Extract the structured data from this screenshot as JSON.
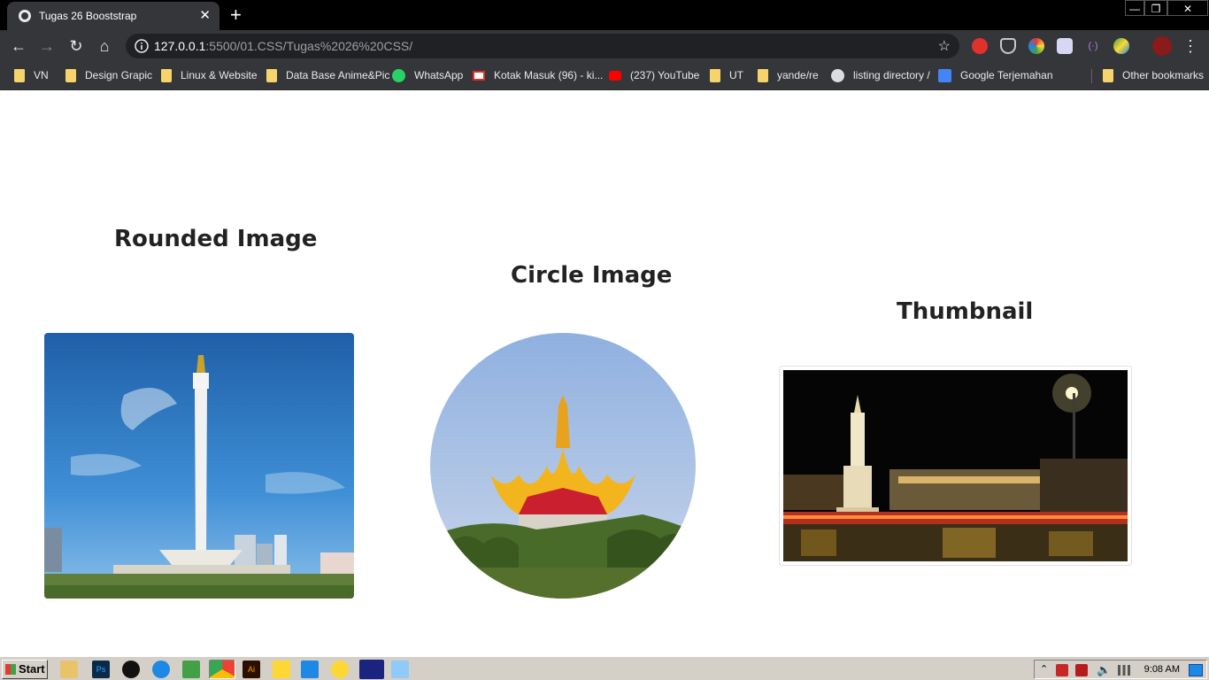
{
  "browser": {
    "tab_title": "Tugas 26 Booststrap",
    "tab_close": "✕",
    "new_tab": "+",
    "url_host": "127.0.0.1",
    "url_rest": ":5500/01.CSS/Tugas%2026%20CSS/",
    "window_controls": {
      "minimize": "—",
      "maximize": "❐",
      "close": "✕"
    }
  },
  "bookmarks": [
    {
      "label": "VN",
      "icon": "folder-icon"
    },
    {
      "label": "Design Grapic",
      "icon": "folder-icon"
    },
    {
      "label": "Linux & Website",
      "icon": "folder-icon"
    },
    {
      "label": "Data Base Anime&Pic",
      "icon": "folder-icon"
    },
    {
      "label": "WhatsApp",
      "icon": "whatsapp-icon"
    },
    {
      "label": "Kotak Masuk (96) - ki...",
      "icon": "gmail-icon"
    },
    {
      "label": "(237) YouTube",
      "icon": "youtube-icon"
    },
    {
      "label": "UT",
      "icon": "folder-icon"
    },
    {
      "label": "yande/re",
      "icon": "folder-icon"
    },
    {
      "label": "listing directory /",
      "icon": "globe-icon"
    },
    {
      "label": "Google Terjemahan",
      "icon": "google-translate-icon"
    },
    {
      "label": "Other bookmarks",
      "icon": "folder-icon"
    }
  ],
  "page": {
    "rounded_title": "Rounded Image",
    "circle_title": "Circle Image",
    "thumbnail_title": "Thumbnail"
  },
  "taskbar": {
    "start_label": "Start",
    "clock": "9:08 AM"
  },
  "colors": {
    "chrome_bg": "#35363a",
    "tab_strip": "#000000",
    "folder": "#f7d46b"
  }
}
